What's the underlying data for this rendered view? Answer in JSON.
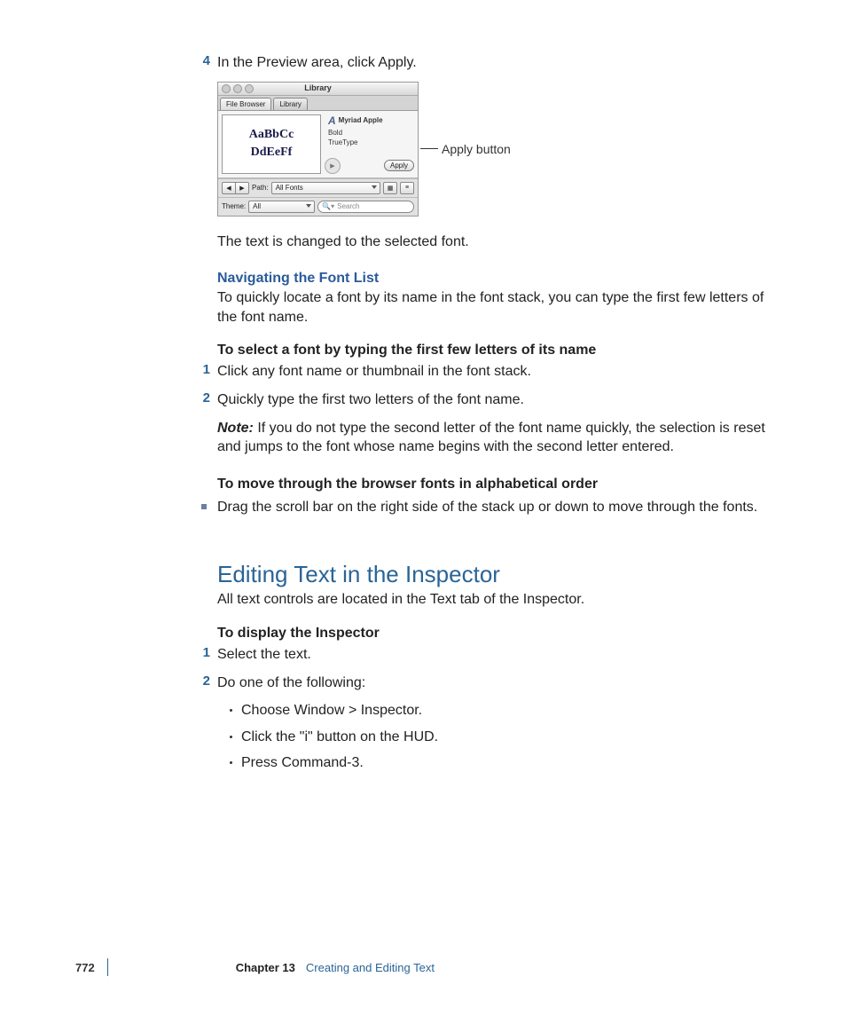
{
  "step4": {
    "num": "4",
    "text": "In the Preview area, click Apply."
  },
  "figure": {
    "title": "Library",
    "tabs": {
      "file_browser": "File Browser",
      "library": "Library"
    },
    "preview": {
      "line1": "AaBbCc",
      "line2": "DdEeFf"
    },
    "font_name": "Myriad Apple",
    "font_weight": "Bold",
    "font_kind": "TrueType",
    "apply_label": "Apply",
    "path_label": "Path:",
    "path_value": "All Fonts",
    "theme_label": "Theme:",
    "theme_value": "All",
    "search_placeholder": "Search",
    "callout": "Apply button"
  },
  "after_fig_text": "The text is changed to the selected font.",
  "nav_heading": "Navigating the Font List",
  "nav_text": "To quickly locate a font by its name in the font stack, you can type the first few letters of the font name.",
  "select_heading": "To select a font by typing the first few letters of its name",
  "select_step1": {
    "num": "1",
    "text": "Click any font name or thumbnail in the font stack."
  },
  "select_step2": {
    "num": "2",
    "text": "Quickly type the first two letters of the font name."
  },
  "note_label": "Note:",
  "note_text": " If you do not type the second letter of the font name quickly, the selection is reset and jumps to the font whose name begins with the second letter entered.",
  "move_heading": "To move through the browser fonts in alphabetical order",
  "move_bullet": "Drag the scroll bar on the right side of the stack up or down to move through the fonts.",
  "section_title": "Editing Text in the Inspector",
  "section_intro": "All text controls are located in the Text tab of the Inspector.",
  "display_heading": "To display the Inspector",
  "display_step1": {
    "num": "1",
    "text": "Select the text."
  },
  "display_step2": {
    "num": "2",
    "text": "Do one of the following:"
  },
  "sub1": "Choose Window > Inspector.",
  "sub2": "Click the \"i\" button on the HUD.",
  "sub3": "Press Command-3.",
  "footer": {
    "page": "772",
    "chapter": "Chapter 13",
    "title": "Creating and Editing Text"
  }
}
